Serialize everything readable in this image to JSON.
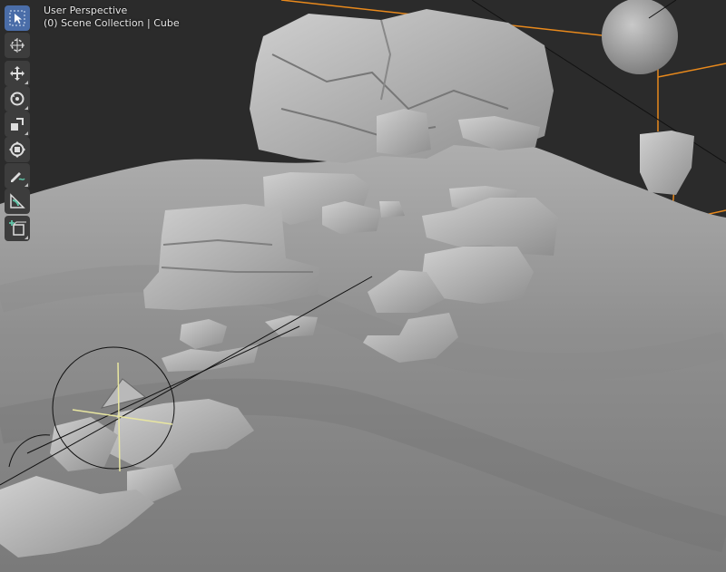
{
  "viewport": {
    "mode_label": "User Perspective",
    "collection_label": "(0) Scene Collection | Cube"
  },
  "toolbar": {
    "tools": [
      {
        "name": "select-box",
        "icon": "cursor-arrow-icon",
        "active": true
      },
      {
        "name": "cursor",
        "icon": "crosshair-cursor-icon",
        "active": false
      },
      {
        "name": "move",
        "icon": "move-arrows-icon",
        "active": false
      },
      {
        "name": "rotate",
        "icon": "rotate-icon",
        "active": false
      },
      {
        "name": "scale",
        "icon": "scale-icon",
        "active": false
      },
      {
        "name": "transform",
        "icon": "transform-icon",
        "active": false
      },
      {
        "name": "annotate",
        "icon": "annotate-pencil-icon",
        "active": false
      },
      {
        "name": "measure",
        "icon": "measure-ruler-icon",
        "active": false
      },
      {
        "name": "add-cube",
        "icon": "add-cube-icon",
        "active": false
      }
    ]
  },
  "colors": {
    "background": "#2b2b2b",
    "terrain": "#8a8a8a",
    "rock": "#b4b4b4",
    "selection_orange": "#e8891c",
    "active_tool": "#4a6da8"
  }
}
